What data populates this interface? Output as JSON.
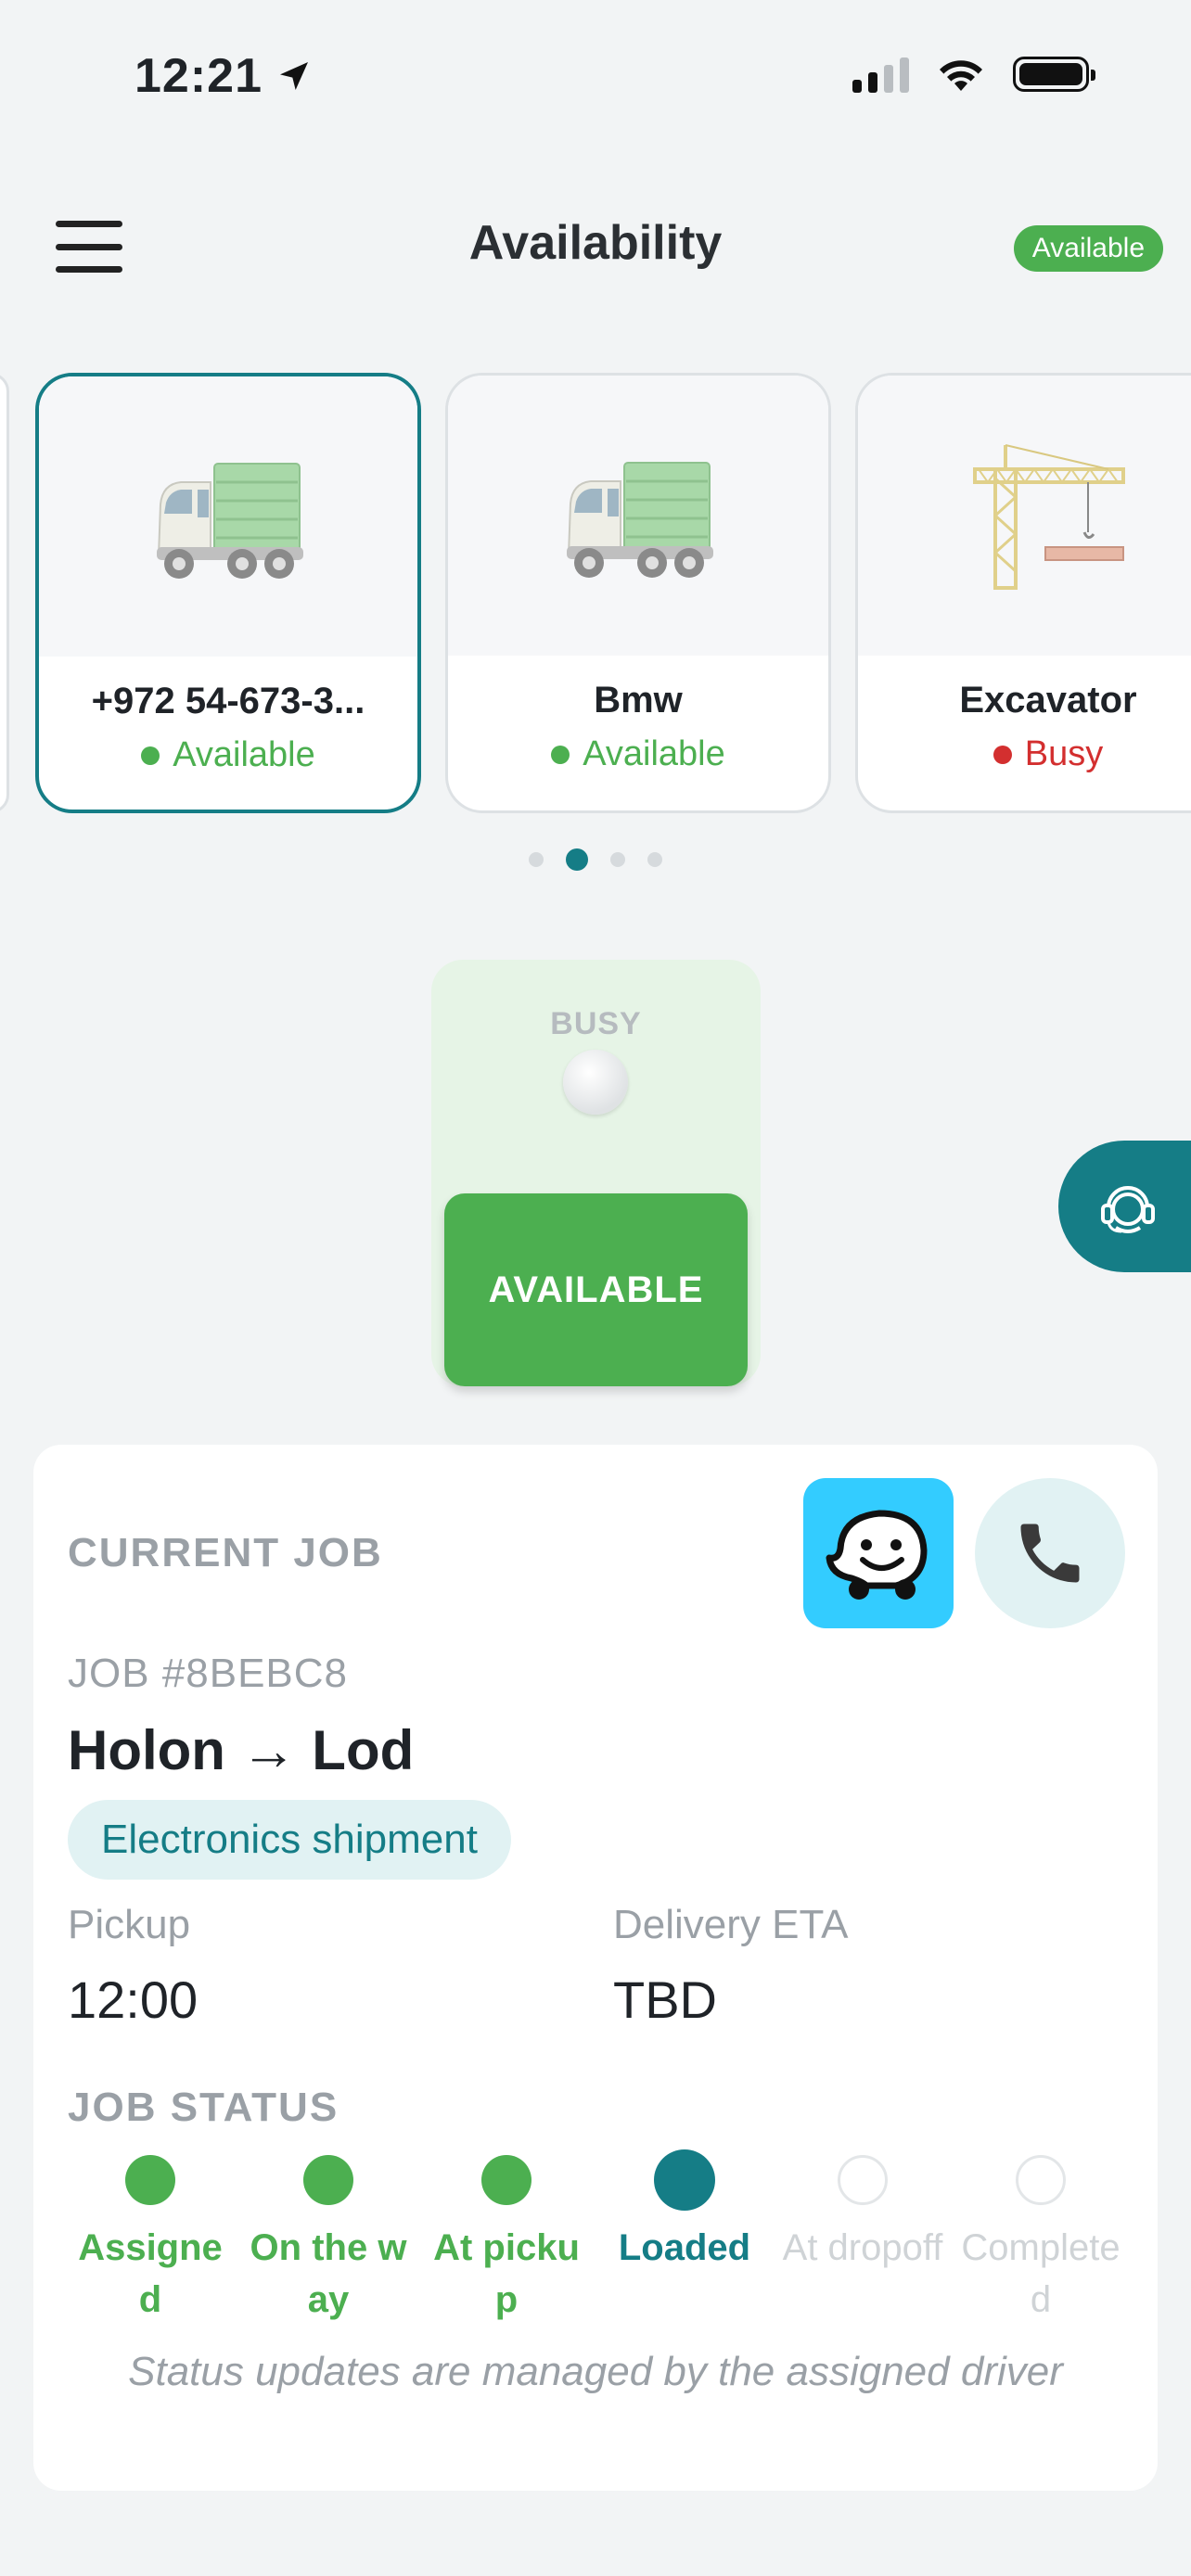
{
  "status_bar": {
    "time": "12:21"
  },
  "header": {
    "title": "Availability",
    "badge": "Available"
  },
  "equipment": [
    {
      "name": "+972 54-673-3...",
      "status": "Available",
      "status_color": "#4caf50",
      "icon": "truck-icon"
    },
    {
      "name": "Bmw",
      "status": "Available",
      "status_color": "#4caf50",
      "icon": "truck-icon"
    },
    {
      "name": "Excavator",
      "status": "Busy",
      "status_color": "#d32f2f",
      "icon": "crane-icon"
    }
  ],
  "toggle": {
    "busy_label": "BUSY",
    "available_label": "AVAILABLE"
  },
  "job": {
    "section_title": "CURRENT JOB",
    "id": "JOB #8BEBC8",
    "route": "Holon → Lod",
    "tag": "Electronics shipment",
    "pickup_label": "Pickup",
    "pickup_value": "12:00",
    "eta_label": "Delivery ETA",
    "eta_value": "TBD",
    "status_title": "JOB STATUS",
    "steps": [
      "Assigned",
      "On the way",
      "At pickup",
      "Loaded",
      "At dropoff",
      "Completed"
    ],
    "note": "Status updates are managed by the assigned driver"
  },
  "colors": {
    "accent": "#157d86",
    "green": "#4caf50",
    "busy": "#d32f2f"
  }
}
